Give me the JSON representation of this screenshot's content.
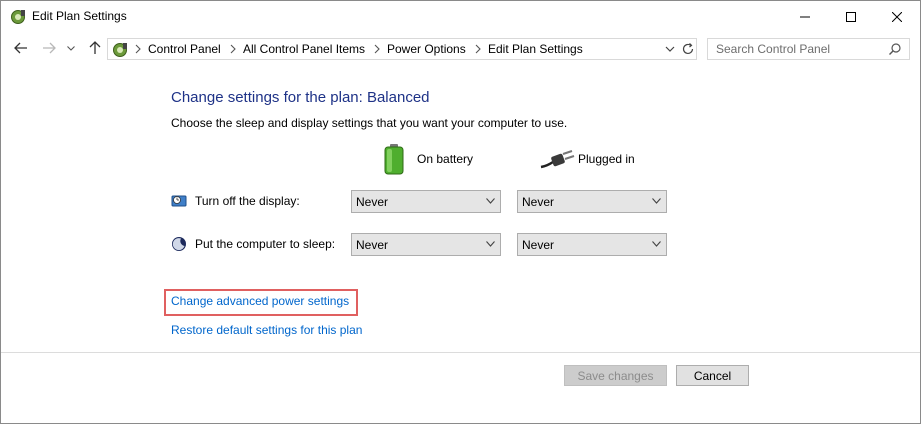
{
  "window": {
    "title": "Edit Plan Settings"
  },
  "titlebar": {
    "minimize_icon": "minimize-icon",
    "maximize_icon": "maximize-icon",
    "close_icon": "close-icon"
  },
  "nav": {
    "breadcrumbs": [
      "Control Panel",
      "All Control Panel Items",
      "Power Options",
      "Edit Plan Settings"
    ],
    "search_placeholder": "Search Control Panel"
  },
  "main": {
    "title": "Change settings for the plan: Balanced",
    "description": "Choose the sleep and display settings that you want your computer to use.",
    "columns": {
      "battery": "On battery",
      "plugged": "Plugged in"
    },
    "rows": [
      {
        "label": "Turn off the display:",
        "battery": "Never",
        "plugged": "Never",
        "icon": "display-icon"
      },
      {
        "label": "Put the computer to sleep:",
        "battery": "Never",
        "plugged": "Never",
        "icon": "sleep-icon"
      }
    ],
    "links": {
      "advanced": "Change advanced power settings",
      "restore": "Restore default settings for this plan"
    }
  },
  "footer": {
    "save": "Save changes",
    "cancel": "Cancel"
  },
  "colors": {
    "title_blue": "#1e3287",
    "link_blue": "#0066cc",
    "highlight_red": "#e06060"
  }
}
